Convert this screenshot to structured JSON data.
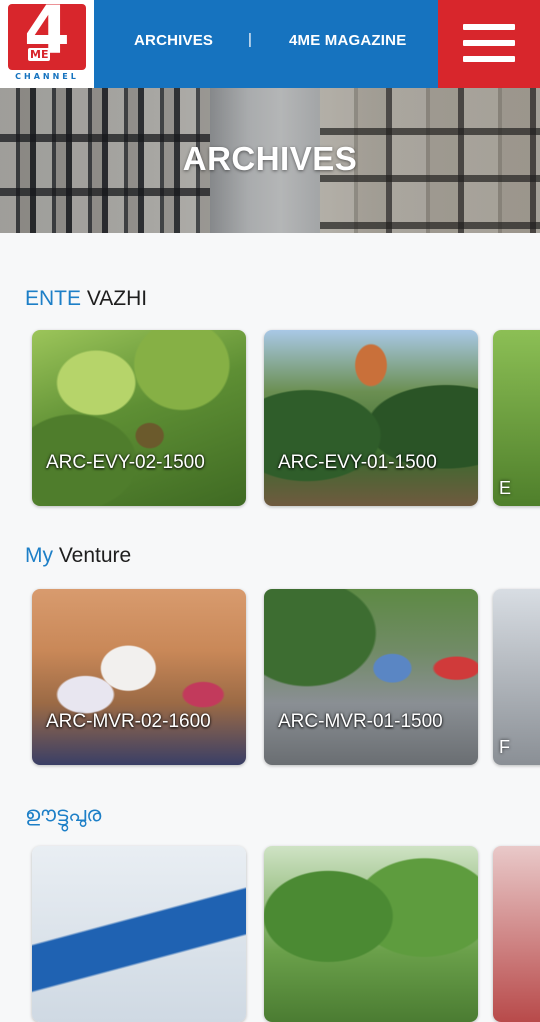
{
  "header": {
    "logo": {
      "number": "4",
      "tag": "ME",
      "subtitle": "CHANNEL"
    },
    "nav": [
      {
        "label": "ARCHIVES"
      },
      {
        "label": "4ME MAGAZINE"
      }
    ],
    "nav_separator": "|",
    "menu_icon": "hamburger-menu-icon"
  },
  "hero": {
    "title": "ARCHIVES"
  },
  "sections": [
    {
      "title_accent": "ENTE",
      "title_rest": " VAZHI",
      "cards": [
        {
          "label": "ARC-EVY-02-1500"
        },
        {
          "label": "ARC-EVY-01-1500"
        },
        {
          "label": "E"
        }
      ]
    },
    {
      "title_accent": "My",
      "title_rest": " Venture",
      "cards": [
        {
          "label": "ARC-MVR-02-1600"
        },
        {
          "label": "ARC-MVR-01-1500"
        },
        {
          "label": "F"
        }
      ]
    },
    {
      "title": "ഊട്ടുപുര",
      "cards": []
    }
  ],
  "colors": {
    "header_blue": "#1673bf",
    "menu_red": "#d8262c",
    "accent_blue": "#1d7fc7",
    "background": "#f7f8f9"
  }
}
